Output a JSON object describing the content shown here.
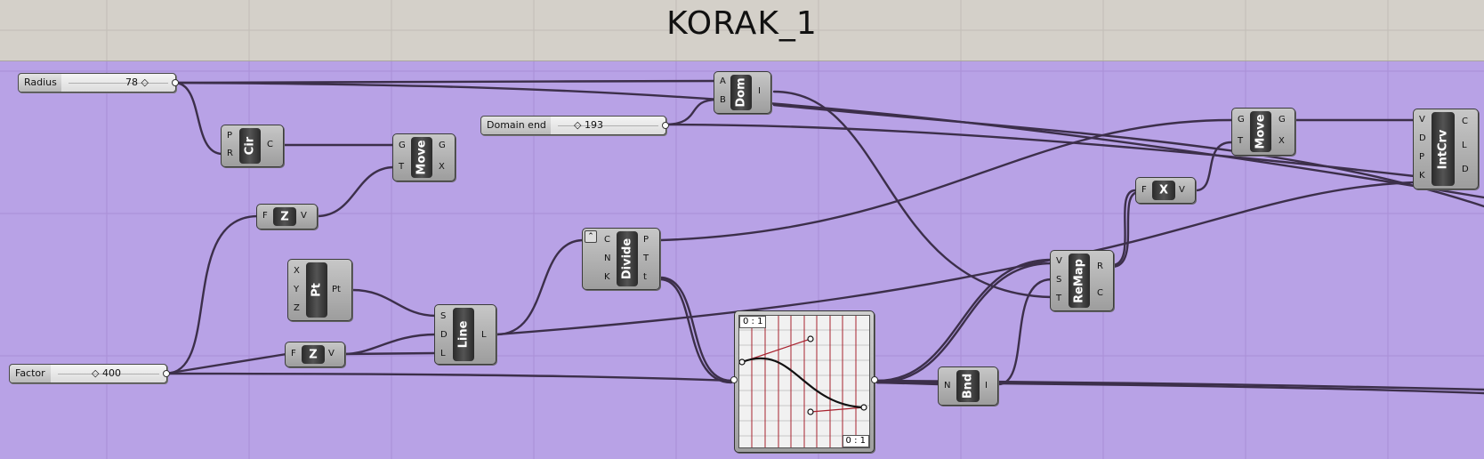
{
  "canvas": {
    "title": "KORAK_1",
    "background": "#b8a2e6",
    "header_color": "#d4d0c9",
    "wire_color": "#3c2f4a"
  },
  "sliders": {
    "radius": {
      "label": "Radius",
      "value": "78 ◇"
    },
    "domain_end": {
      "label": "Domain end",
      "value": "◇ 193"
    },
    "factor": {
      "label": "Factor",
      "value": "◇ 400"
    }
  },
  "components": {
    "circle": {
      "name": "Cir",
      "inputs": [
        "P",
        "R"
      ],
      "outputs": [
        "C"
      ]
    },
    "move1": {
      "name": "Move",
      "inputs": [
        "G",
        "T"
      ],
      "outputs": [
        "G",
        "X"
      ]
    },
    "unitz1": {
      "name": "Z",
      "inputs": [
        "F"
      ],
      "outputs": [
        "V"
      ]
    },
    "point": {
      "name": "Pt",
      "inputs": [
        "X",
        "Y",
        "Z"
      ],
      "outputs": [
        "Pt"
      ]
    },
    "unitz2": {
      "name": "Z",
      "inputs": [
        "F"
      ],
      "outputs": [
        "V"
      ]
    },
    "line": {
      "name": "Line",
      "inputs": [
        "S",
        "D",
        "L"
      ],
      "outputs": [
        "L"
      ]
    },
    "divide": {
      "name": "Divide",
      "inputs": [
        "C",
        "N",
        "K"
      ],
      "outputs": [
        "P",
        "T",
        "t"
      ]
    },
    "domain": {
      "name": "Dom",
      "inputs": [
        "A",
        "B"
      ],
      "outputs": [
        "I"
      ]
    },
    "bounds": {
      "name": "Bnd",
      "inputs": [
        "N"
      ],
      "outputs": [
        "I"
      ]
    },
    "remap": {
      "name": "ReMap",
      "inputs": [
        "V",
        "S",
        "T"
      ],
      "outputs": [
        "R",
        "C"
      ]
    },
    "unitx": {
      "name": "X",
      "inputs": [
        "F"
      ],
      "outputs": [
        "V"
      ]
    },
    "move2": {
      "name": "Move",
      "inputs": [
        "G",
        "T"
      ],
      "outputs": [
        "G",
        "X"
      ]
    },
    "intcrv": {
      "name": "IntCrv",
      "inputs": [
        "V",
        "D",
        "P",
        "K"
      ],
      "outputs": [
        "C",
        "L",
        "D"
      ]
    }
  },
  "graph_mapper": {
    "top_label": "0 : 1",
    "bottom_label": "0 : 1"
  }
}
